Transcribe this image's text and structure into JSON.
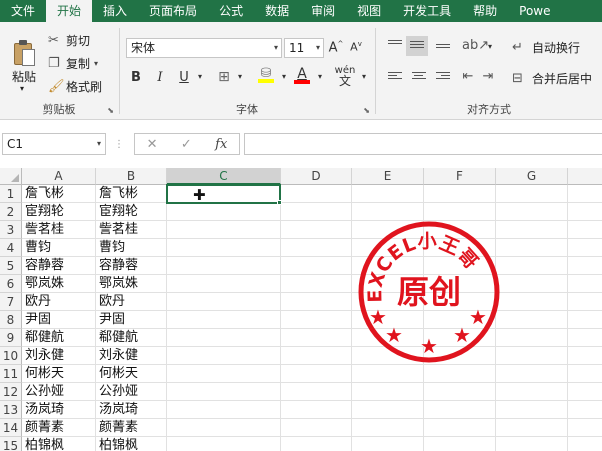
{
  "menu": {
    "tabs": [
      "文件",
      "开始",
      "插入",
      "页面布局",
      "公式",
      "数据",
      "审阅",
      "视图",
      "开发工具",
      "帮助",
      "Powe"
    ],
    "active_index": 1
  },
  "ribbon": {
    "clipboard": {
      "paste": "粘贴",
      "cut": "剪切",
      "copy": "复制",
      "format_painter": "格式刷",
      "label": "剪贴板"
    },
    "font": {
      "font_name": "宋体",
      "font_size": "11",
      "bold": "B",
      "italic": "I",
      "underline": "U",
      "grow": "A",
      "shrink": "A",
      "font_color_letter": "A",
      "phonetic": "wén",
      "label": "字体",
      "highlight_color": "#ffff00",
      "font_color": "#ff0000"
    },
    "alignment": {
      "wrap_text": "自动换行",
      "merge_center": "合并后居中",
      "label": "对齐方式"
    }
  },
  "formula_bar": {
    "name_box": "C1",
    "cancel": "✕",
    "enter": "✓",
    "fx": "fx",
    "content": ""
  },
  "sheet": {
    "columns": [
      "A",
      "B",
      "C",
      "D",
      "E",
      "F",
      "G"
    ],
    "selected_column": "C",
    "rows": [
      {
        "n": "1",
        "a": "詹飞彬",
        "b": "詹飞彬"
      },
      {
        "n": "2",
        "a": "宦翔轮",
        "b": "宦翔轮"
      },
      {
        "n": "3",
        "a": "訾茗桂",
        "b": "訾茗桂"
      },
      {
        "n": "4",
        "a": "曹钧",
        "b": "曹钧"
      },
      {
        "n": "5",
        "a": "容静蓉",
        "b": "容静蓉"
      },
      {
        "n": "6",
        "a": "鄂岚姝",
        "b": "鄂岚姝"
      },
      {
        "n": "7",
        "a": "欧丹",
        "b": "欧丹"
      },
      {
        "n": "8",
        "a": "尹固",
        "b": "尹固"
      },
      {
        "n": "9",
        "a": "郗健航",
        "b": "郗健航"
      },
      {
        "n": "10",
        "a": "刘永健",
        "b": "刘永健"
      },
      {
        "n": "11",
        "a": "何彬天",
        "b": "何彬天"
      },
      {
        "n": "12",
        "a": "公孙娅",
        "b": "公孙娅"
      },
      {
        "n": "13",
        "a": "汤岚琦",
        "b": "汤岚琦"
      },
      {
        "n": "14",
        "a": "颜菁素",
        "b": "颜菁素"
      },
      {
        "n": "15",
        "a": "柏锦枫",
        "b": "柏锦枫"
      }
    ],
    "active_cell": "C1"
  },
  "stamp": {
    "arc_text": "EXCEL小王哥",
    "center_text": "原创",
    "color": "#e0141e"
  },
  "colors": {
    "brand_green": "#217346"
  }
}
